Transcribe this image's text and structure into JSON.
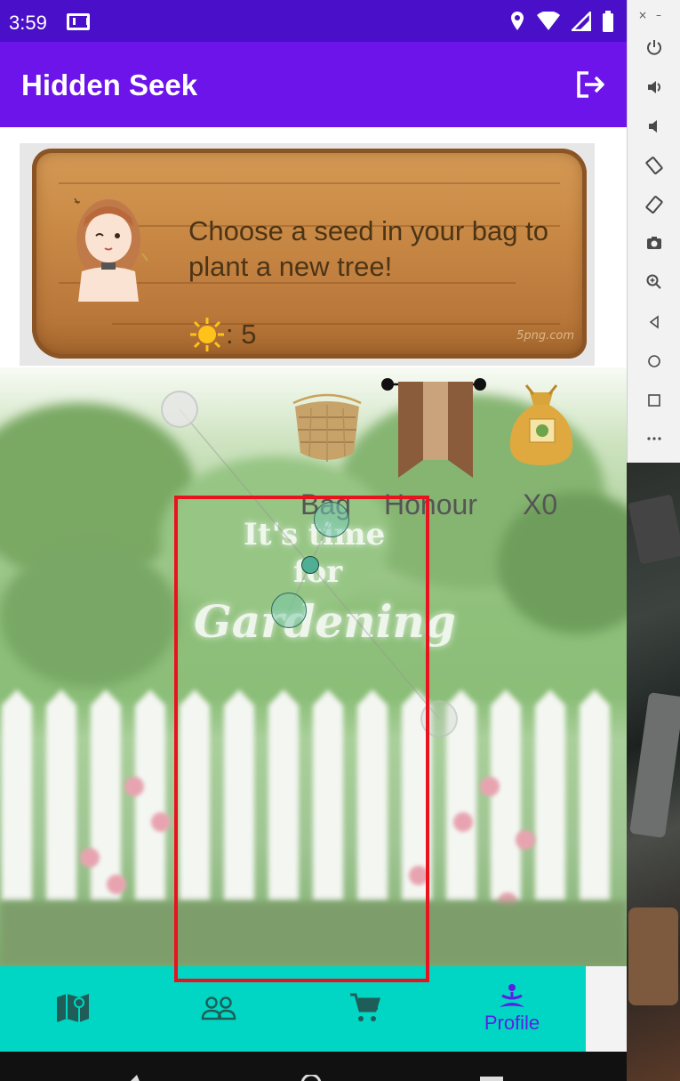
{
  "status": {
    "time": "3:59"
  },
  "app": {
    "title": "Hidden Seek"
  },
  "sign": {
    "message": "Choose a seed in your bag to plant a new tree!",
    "sun_text": ": 5",
    "watermark": "5png.com"
  },
  "tools": {
    "bag_label": "Bag",
    "honour_label": "Honour",
    "seed_label": "X0"
  },
  "garden_art": {
    "line1": "It's time",
    "line2": "for",
    "line3": "Gardening"
  },
  "tabs": [
    {
      "name": "map",
      "label": ""
    },
    {
      "name": "friends",
      "label": ""
    },
    {
      "name": "shop",
      "label": ""
    },
    {
      "name": "profile",
      "label": "Profile"
    }
  ],
  "colors": {
    "status_bar": "#4a0fc9",
    "app_bar": "#6c14ea",
    "tab_bar": "#00d6c3",
    "tab_active": "#5a1fe6",
    "highlight": "#e8131f"
  }
}
